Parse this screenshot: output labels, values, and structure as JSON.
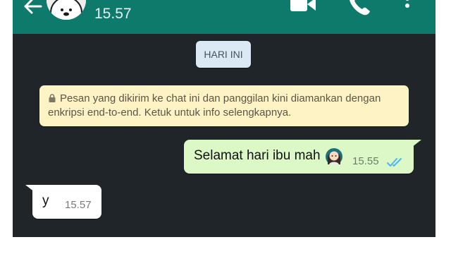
{
  "header": {
    "last_seen": "15.57",
    "icons": [
      "back-arrow",
      "avatar",
      "video-call",
      "voice-call",
      "more-options"
    ]
  },
  "chat": {
    "date_chip": "HARI INI",
    "encryption_notice": {
      "line1": "Pesan yang dikirim ke chat ini dan panggilan kini diamankan dengan",
      "line2": "enkripsi end-to-end. Ketuk untuk info selengkapnya."
    },
    "messages": [
      {
        "direction": "outgoing",
        "text": "Selamat hari ibu mah",
        "emoji": "woman-face",
        "time": "15.55",
        "status": "read"
      },
      {
        "direction": "incoming",
        "text": "y",
        "time": "15.57"
      }
    ]
  },
  "colors": {
    "app_bar": "#0e7a6c",
    "chat_background": "#1f2529",
    "outgoing_bubble": "#dcf8c6",
    "incoming_bubble": "#ffffff",
    "date_chip": "#dbe9f4",
    "encryption_notice": "#fdf3c4",
    "read_ticks": "#4fb6ec"
  }
}
